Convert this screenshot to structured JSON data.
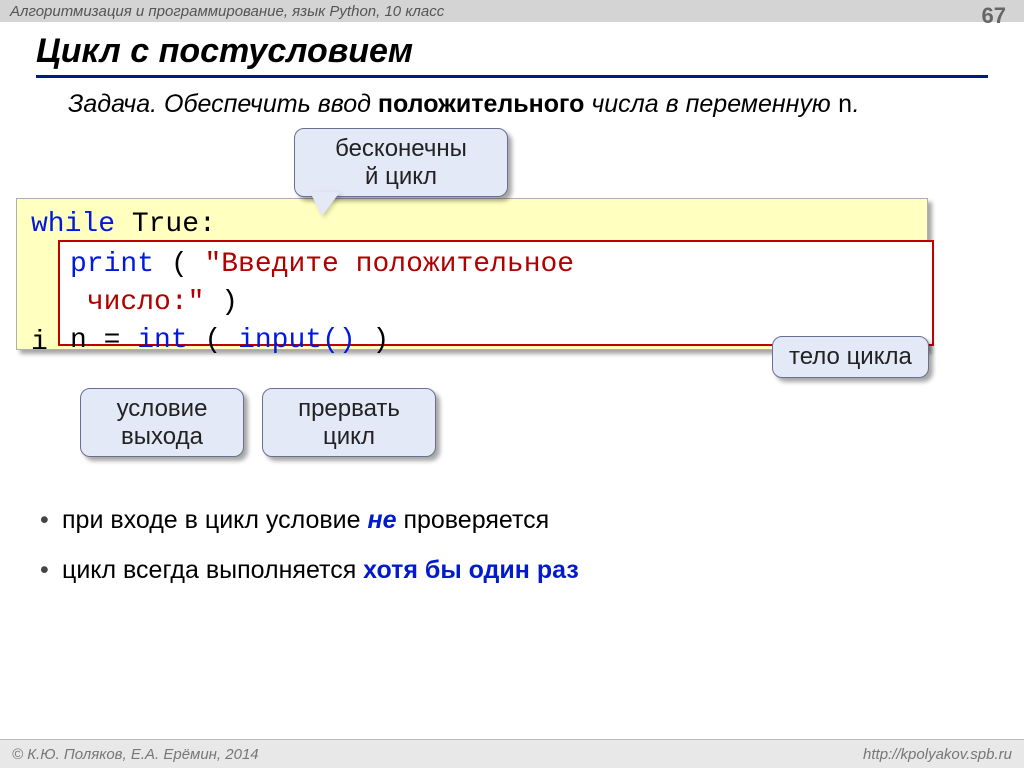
{
  "header": {
    "breadcrumb": "Алгоритмизация и программирование, язык Python, 10 класс",
    "page": "67"
  },
  "title": "Цикл с постусловием",
  "task": {
    "label": "Задача",
    "t1": ". Обеспечить ввод ",
    "bold": "положительного",
    "t2": " числа в переменную ",
    "var": "n",
    "t3": "."
  },
  "code": {
    "l1a": "while",
    "l1b": " True:",
    "l2_i": "i"
  },
  "inner": {
    "print": "print",
    "open": "   (    ",
    "str1": "\"Введите    положительное",
    "str2": "число:\"",
    "close": " )",
    "l2a": "n = ",
    "int": "int",
    "l2b": " ( ",
    "input": "input()",
    "l2c": " )"
  },
  "callouts": {
    "infinite": "бесконечны\nй цикл",
    "body": "тело цикла",
    "exit": "условие\nвыхода",
    "break": "прервать\nцикл"
  },
  "points": {
    "p1a": "при входе в цикл условие ",
    "p1b": "не",
    "p1c": " проверяется",
    "p2a": "цикл всегда выполняется ",
    "p2b": "хотя бы один раз"
  },
  "footer": {
    "left": "© К.Ю. Поляков, Е.А. Ерёмин, 2014",
    "right": "http://kpolyakov.spb.ru"
  }
}
